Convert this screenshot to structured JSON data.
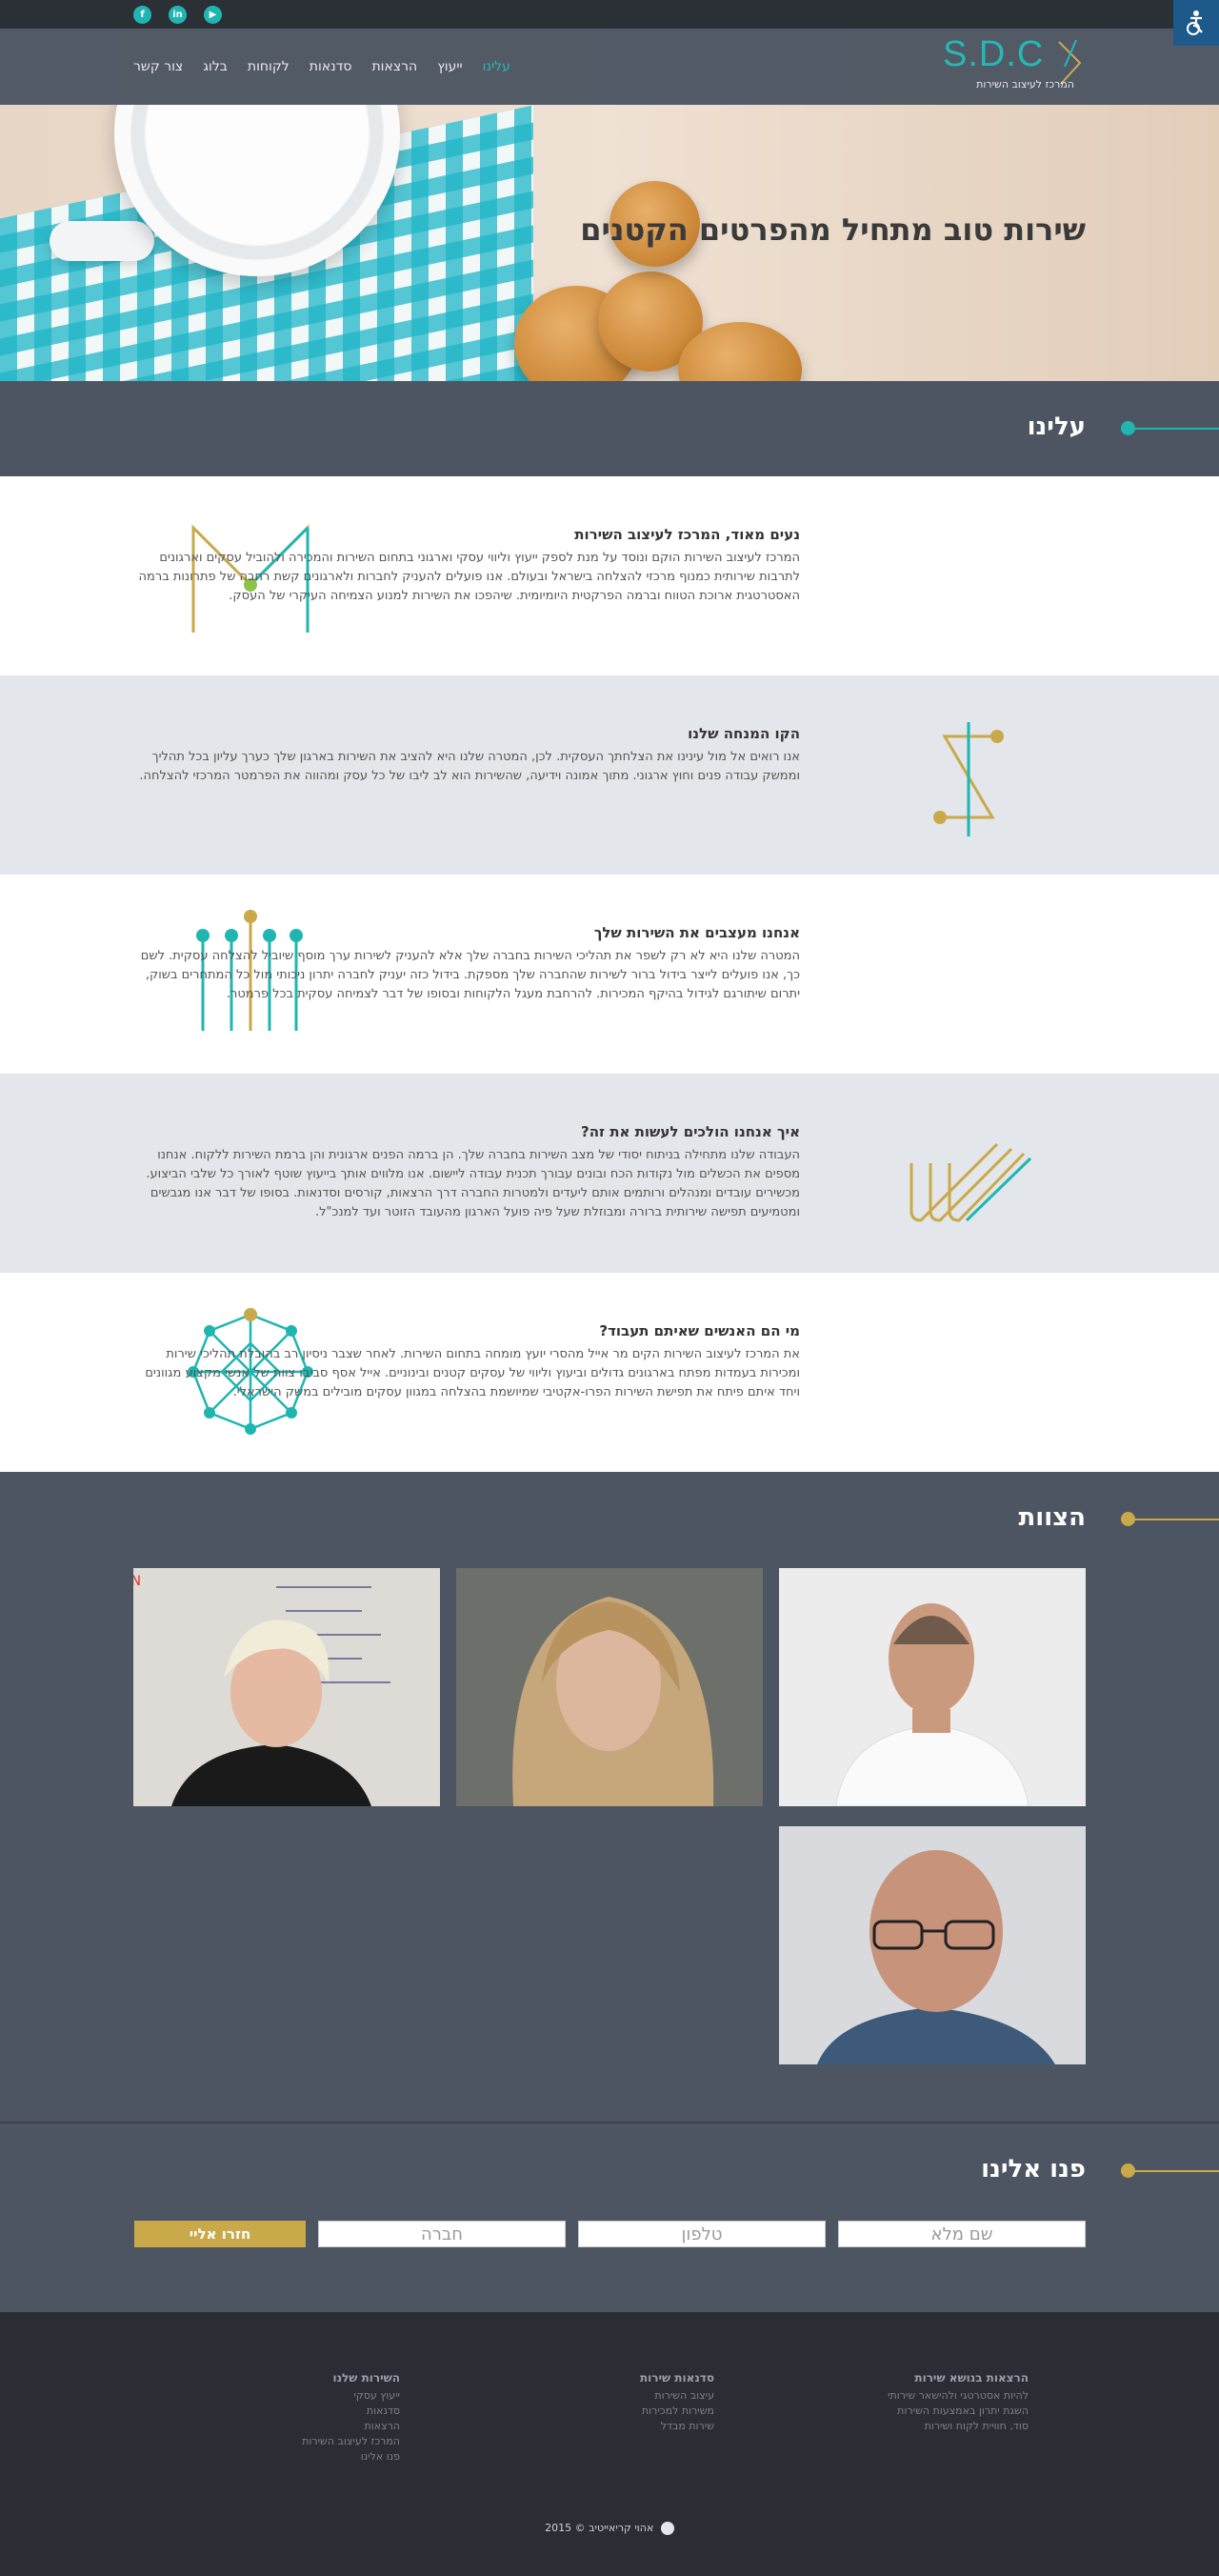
{
  "topbar": {
    "social": [
      {
        "icon": "youtube-icon",
        "glyph": "▶"
      },
      {
        "icon": "linkedin-icon",
        "glyph": "in"
      },
      {
        "icon": "facebook-icon",
        "glyph": "f"
      }
    ]
  },
  "nav": {
    "items": [
      "עלינו",
      "ייעוץ",
      "הרצאות",
      "סדנאות",
      "לקוחות",
      "בלוג",
      "צור קשר"
    ],
    "active_index": 0
  },
  "logo": {
    "mark": "S.D.C",
    "subtitle": "המרכז לעיצוב השירות"
  },
  "hero": {
    "title_regular": "שירות טוב מתחיל ",
    "title_bold": "מהפרטים הקטנים"
  },
  "about": {
    "heading": "עלינו",
    "blocks": [
      {
        "title": "נעים מאוד, המרכז לעיצוב השירות",
        "text": "המרכז לעיצוב השירות הוקם ונוסד על מנת לספק ייעוץ וליווי עסקי וארגוני בתחום השירות והמכירה ולהוביל עסקים וארגונים לתרבות שירותית כמנוף מרכזי להצלחה בישראל ובעולם. אנו פועלים להעניק לחברות ולארגונים קשת רחבה של פתרונות ברמה האסטרטגית ארוכת הטווח וברמה הפרקטית היומיומית. שיהפכו את השירות למנוע הצמיחה העיקרי של העסק."
      },
      {
        "title": "הקו המנחה שלנו",
        "text": "אנו רואים אל מול עינינו את הצלחתך העסקית. לכן, המטרה שלנו היא להציב את השירות בארגון שלך כערך עליון בכל תהליך וממשק עבודה פנים וחוץ ארגוני. מתוך אמונה וידיעה, שהשירות הוא לב ליבו של כל עסק ומהווה את הפרמטר המרכזי להצלחה."
      },
      {
        "title": "אנחנו מעצבים את השירות שלך",
        "text": "המטרה שלנו היא לא רק לשפר את תהליכי השירות בחברה שלך אלא להעניק לשירות ערך מוסף שיוביל להצלחה עסקית. לשם כך, אנו פועלים לייצר בידול ברור לשירות שהחברה שלך מספקת. בידול כזה יעניק לחברה יתרון ניכותי מול כל המתחרים בשוק, יתרום שיתורגם לגידול בהיקף המכירות. להרחבת מעגל הלקוחות ובסופו של דבר לצמיחה עסקית בכל פרמטר."
      },
      {
        "title": "איך אנחנו הולכים לעשות את זה?",
        "text": "העבודה שלנו מתחילה בניתוח יסודי של מצב השירות בחברה שלך. הן ברמה הפנים ארגונית והן ברמת השירות ללקוח. אנחנו מספים את הכשלים מול נקודות הכח ובונים עבורך תכנית עבודה ליישום. אנו מלווים אותך בייעוץ שוטף לאורך כל שלבי הביצוע. מכשירים עובדים ומנהלים ורותמים אותם ליעדים ולמטרות החברה דרך הרצאות, קורסים וסדנאות. בסופו של דבר אנו מגבשים ומטמיעים תפישה שירותית ברורה ומבוזלת שעל פיה פועל הארגון מהעובד הזוטר ועד למנכ\"ל."
      },
      {
        "title": "מי הם האנשים שאיתם תעבוד?",
        "text": "את המרכז לעיצוב השירות הקים מר אייל מהסרי יועץ מומחה בתחום השירות. לאחר שצבר ניסיון רב בהובלת תהליכי שירות ומכירות בעמדות מפתח בארגונים גדולים וביעוץ וליווי של עסקים קטנים ובינוניים. אייל אסף סביבו צוות של אנשי מקצוע מגוונים ויחד איתם פיתח את תפישת השירות הפרו-אקטיבי שמיושמת בהצלחה במגוון עסקים מובילים במשק הישראלי."
      }
    ]
  },
  "team": {
    "heading": "הצוות"
  },
  "contact": {
    "heading": "פנו אלינו",
    "fields": [
      "שם מלא",
      "טלפון",
      "חברה"
    ],
    "submit": "חזרו אליי"
  },
  "footer": {
    "columns": [
      {
        "title": "השירות שלנו",
        "items": [
          "ייעוץ עסקי",
          "סדנאות",
          "הרצאות",
          "המרכז לעיצוב השירות",
          "פנו אלינו"
        ]
      },
      {
        "title": "סדנאות שירות",
        "items": [
          "עיצוב השירות",
          "משירות למכירות",
          "שירות מבדל"
        ]
      },
      {
        "title": "הרצאות בנושא שירות",
        "items": [
          "להיות אסטרטגי ולהישאר שירותי",
          "השגת יתרון באמצעות השירות",
          "סוד, חוויית לקוח ושירות"
        ]
      }
    ],
    "copyright": "אהוי קריאייטיב © 2015"
  },
  "colors": {
    "accent_teal": "#1fb6b1",
    "accent_gold": "#c9a94a",
    "dark": "#4d5562"
  }
}
